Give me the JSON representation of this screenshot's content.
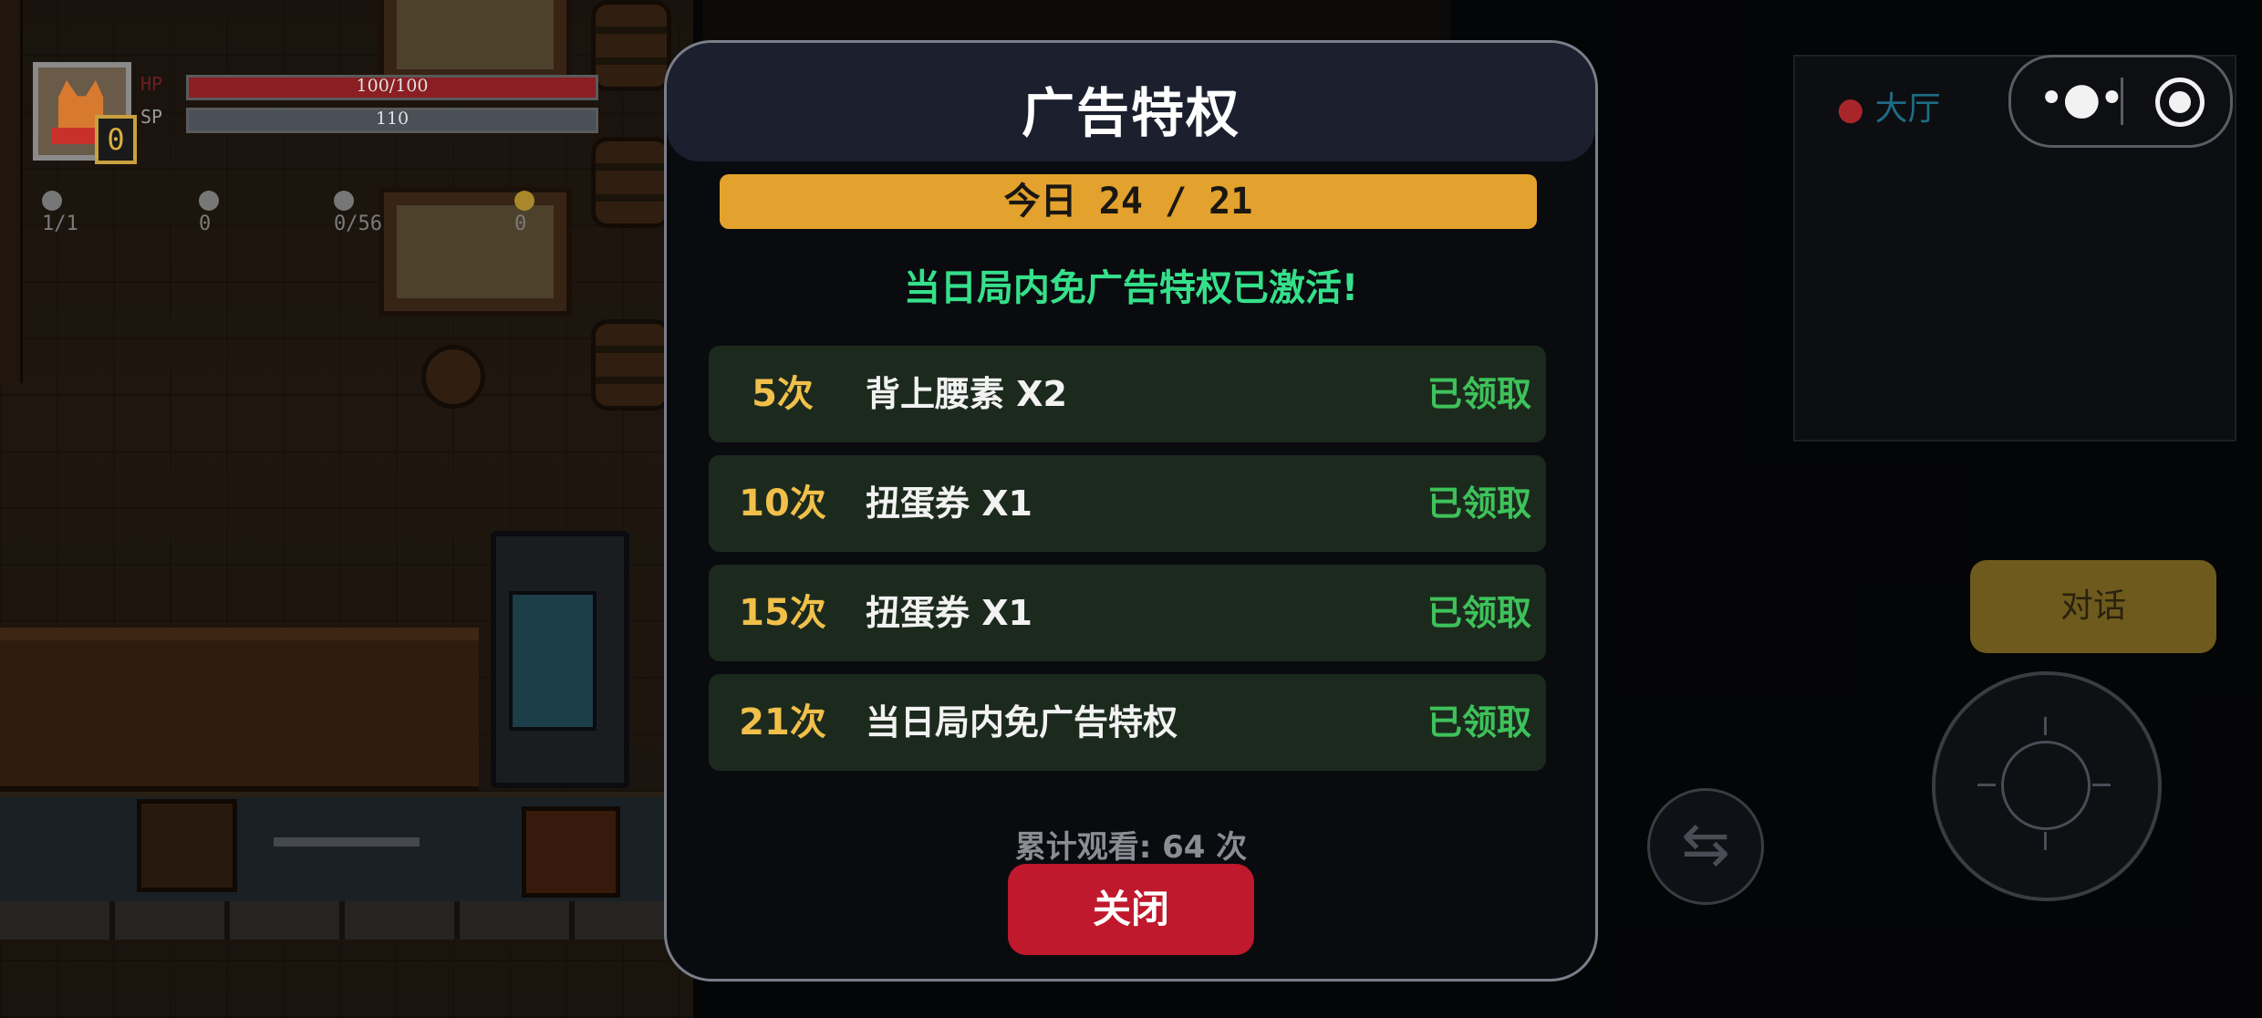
{
  "hud": {
    "hp_label": "HP",
    "hp_value": "100/100",
    "sp_label": "SP",
    "sp_value": "110",
    "level": "0",
    "weapon_count": "1/1",
    "kill_count": "0",
    "bag_count": "0/56",
    "coin_count": "0"
  },
  "minimap": {
    "location": "大厅"
  },
  "capsule": {
    "more_icon": "more-dots-icon",
    "record_icon": "record-icon"
  },
  "actions": {
    "talk_label": "对话",
    "swap_icon": "swap-arrows-icon"
  },
  "modal": {
    "title": "广告特权",
    "daily_progress": "今日 24 / 21",
    "activated_text": "当日局内免广告特权已激活!",
    "rewards": [
      {
        "count": "5次",
        "reward": "背上腰素 X2",
        "status": "已领取"
      },
      {
        "count": "10次",
        "reward": "扭蛋券 X1",
        "status": "已领取"
      },
      {
        "count": "15次",
        "reward": "扭蛋券 X1",
        "status": "已领取"
      },
      {
        "count": "21次",
        "reward": "当日局内免广告特权",
        "status": "已领取"
      }
    ],
    "total_watched": "累计观看: 64 次",
    "close_label": "关闭"
  },
  "colors": {
    "modal_bg": "#0a0b0f",
    "header_bg": "#1c1f2d",
    "progress_bar": "#e3a22d",
    "activated_green": "#35e08a",
    "claimed_green": "#3ec25a",
    "count_gold": "#f1c04a",
    "close_red": "#c0182c",
    "talk_button": "#6e5a1c"
  }
}
